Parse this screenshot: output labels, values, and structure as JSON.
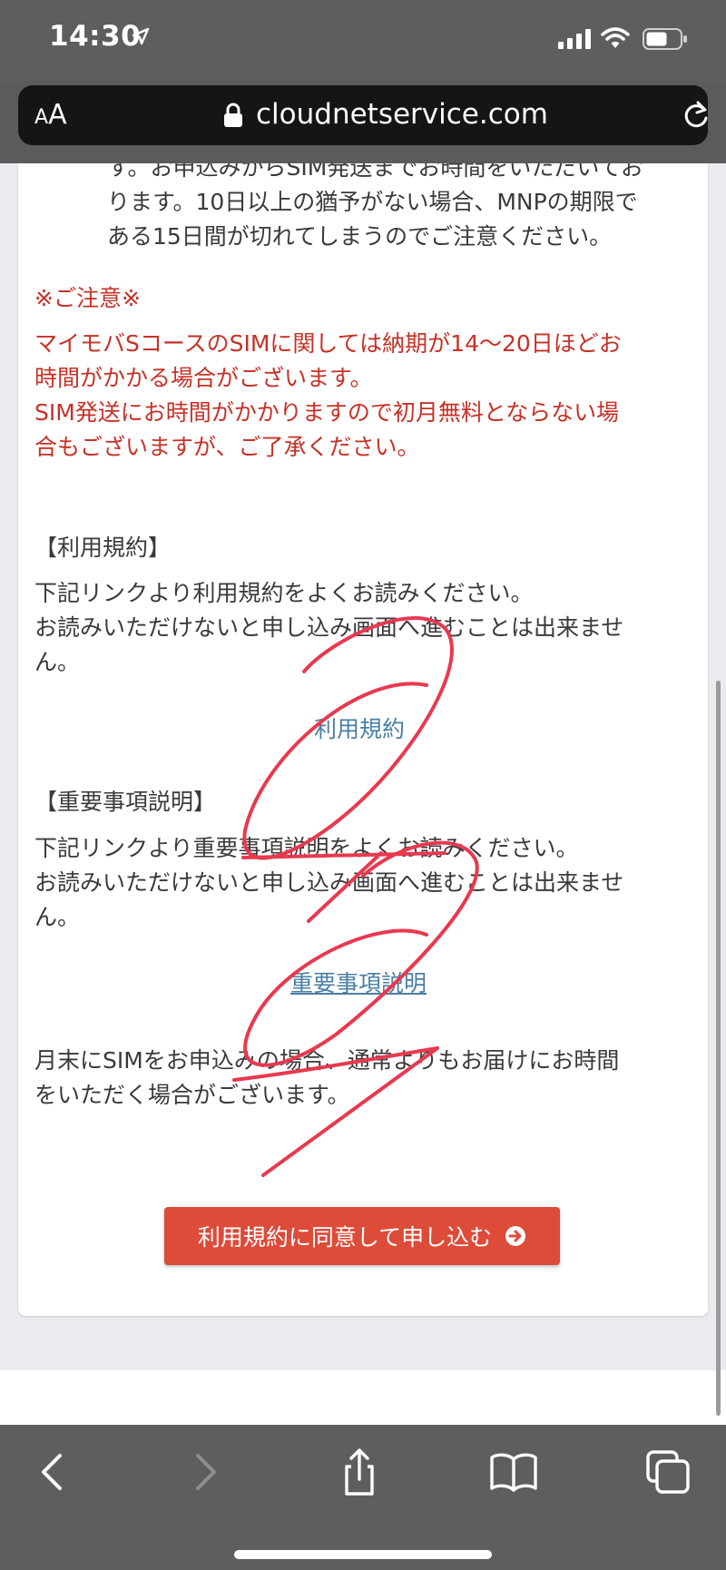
{
  "status_bar": {
    "time": "14:30"
  },
  "address_bar": {
    "text_size_button": {
      "small": "A",
      "large": "A"
    },
    "url": "cloudnetservice.com"
  },
  "content": {
    "intro_lines": [
      "す。お申込みからSIM発送までお時間をいただいてお",
      "ります。10日以上の猶予がない場合、MNPの期限で",
      "ある15日間が切れてしまうのでご注意ください。"
    ],
    "notice_heading": "※ご注意※",
    "notice_lines": [
      "マイモバSコースのSIMに関しては納期が14〜20日ほどお",
      "時間がかかる場合がございます。",
      "SIM発送にお時間がかかりますので初月無料とならない場",
      "合もございますが、ご了承ください。"
    ],
    "terms_heading": "【利用規約】",
    "terms_lines": [
      "下記リンクより利用規約をよくお読みください。",
      "お読みいただけないと申し込み画面へ進むことは出来ませ",
      "ん。"
    ],
    "terms_link": "利用規約",
    "important_heading": "【重要事項説明】",
    "important_lines": [
      "下記リンクより重要事項説明をよくお読みください。",
      "お読みいただけないと申し込み画面へ進むことは出来ませ",
      "ん。"
    ],
    "important_link": "重要事項説明",
    "month_end_lines": [
      "月末にSIMをお申込みの場合、通常よりもお届けにお時間",
      "をいただく場合がございます。"
    ],
    "submit_button": "利用規約に同意して申し込む"
  },
  "colors": {
    "notice_red": "#c73127",
    "link_blue": "#4a7ea5",
    "button_red": "#dd4b39",
    "annotation_pink": "#e8394f"
  },
  "icons": {
    "location": "location-arrow-icon",
    "signal": "cellular-signal-icon",
    "wifi": "wifi-icon",
    "battery": "battery-icon",
    "lock": "lock-icon",
    "reload": "reload-icon",
    "submit": "arrow-circle-right-icon",
    "back": "back-chevron-icon",
    "forward": "forward-chevron-icon",
    "share": "share-icon",
    "bookmarks": "bookmarks-icon",
    "tabs": "tabs-icon"
  }
}
